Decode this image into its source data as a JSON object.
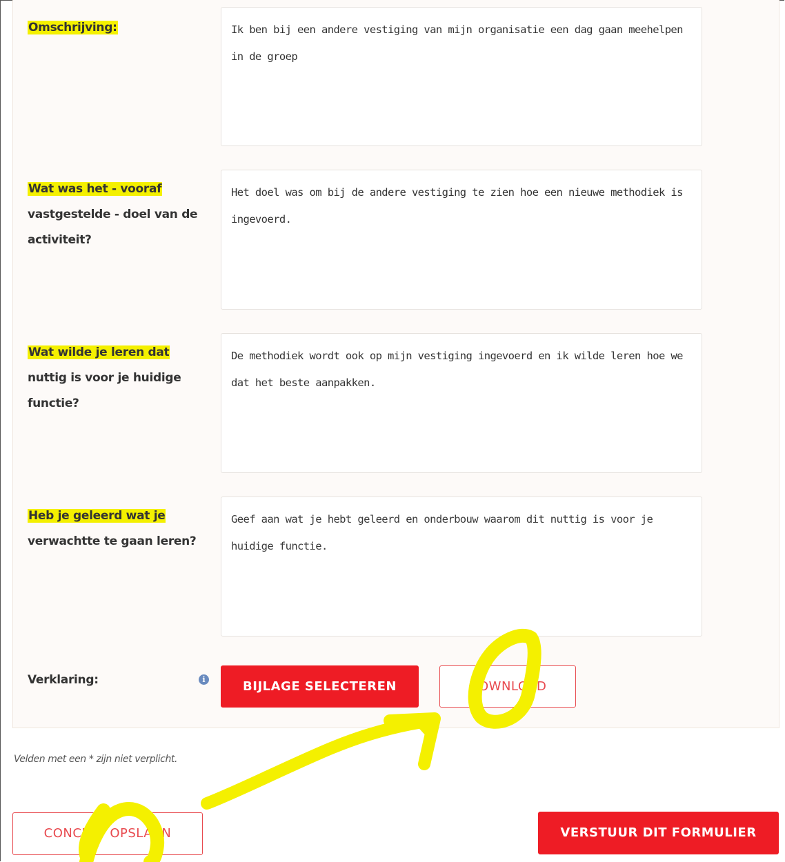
{
  "fields": [
    {
      "label_highlight": "Omschrijving:",
      "label_rest": "",
      "value": "Ik ben bij een andere vestiging van mijn organisatie een dag gaan meehelpen\nin de groep"
    },
    {
      "label_highlight": "Wat was het - vooraf",
      "label_rest": "vastgestelde - doel van de\nactiviteit?",
      "value": "Het doel was om bij de andere vestiging te zien hoe een nieuwe methodiek is\ningevoerd."
    },
    {
      "label_highlight": "Wat wilde je leren dat",
      "label_rest": "nuttig is voor je huidige\nfunctie?",
      "value": "De methodiek wordt ook op mijn vestiging ingevoerd en ik wilde leren hoe we\ndat het beste aanpakken."
    },
    {
      "label_highlight": "Heb je geleerd wat je",
      "label_rest": "verwachtte te gaan leren?",
      "value": "Geef aan wat je hebt geleerd en onderbouw waarom dit nuttig is voor je\nhuidige functie."
    }
  ],
  "verklaring": {
    "label": "Verklaring:",
    "info_icon": "info-icon",
    "select_button": "BIJLAGE SELECTEREN",
    "download_button": "DOWNLOAD"
  },
  "note": "Velden met een * zijn niet verplicht.",
  "footer": {
    "concept_button": "CONCEPT OPSLAAN",
    "submit_button": "VERSTUUR DIT FORMULIER"
  },
  "colors": {
    "accent_red": "#ee1c25",
    "highlight_yellow": "#f4f000",
    "annotation_yellow": "#f4f000"
  }
}
